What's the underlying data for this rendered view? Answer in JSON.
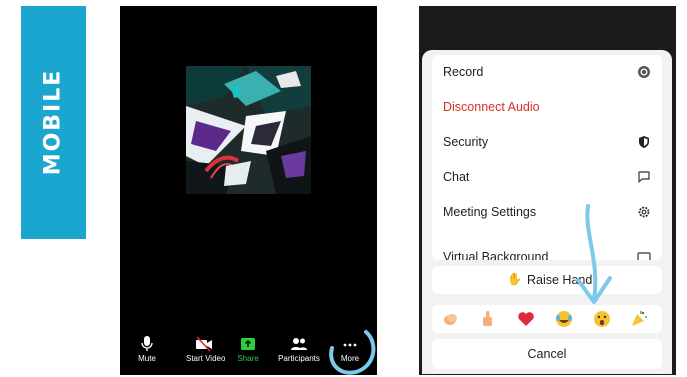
{
  "side_label": "MOBILE",
  "meeting_toolbar": {
    "mute": "Mute",
    "start_video": "Start Video",
    "share": "Share",
    "participants": "Participants",
    "more": "More"
  },
  "more_menu": {
    "items": [
      {
        "label": "Record",
        "icon": "record-icon"
      },
      {
        "label": "Disconnect Audio",
        "icon": ""
      },
      {
        "label": "Security",
        "icon": "shield-icon"
      },
      {
        "label": "Chat",
        "icon": "chat-bubble-icon"
      },
      {
        "label": "Meeting Settings",
        "icon": "gear-icon"
      },
      {
        "label": "Virtual Background",
        "icon": "image-icon"
      }
    ],
    "raise_hand": "Raise Hand",
    "reactions": [
      "clap",
      "thumbs-up",
      "heart",
      "joy",
      "open-mouth",
      "tada"
    ],
    "cancel": "Cancel"
  },
  "colors": {
    "label_bar": "#1aa6cf",
    "highlight": "#7ec8ea",
    "danger": "#d93025",
    "share_green": "#2ecc40"
  }
}
